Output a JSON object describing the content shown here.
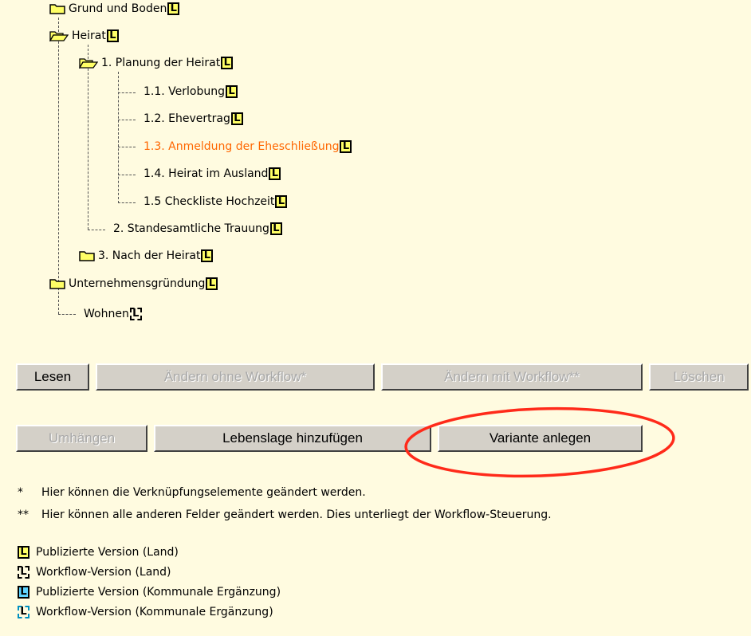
{
  "tree": {
    "items": [
      {
        "label": "Grund und Boden",
        "badge": "L"
      },
      {
        "label": "Heirat",
        "badge": "L"
      },
      {
        "label": "1. Planung der Heirat",
        "badge": "L"
      },
      {
        "label": "1.1. Verlobung",
        "badge": "L"
      },
      {
        "label": "1.2. Ehevertrag",
        "badge": "L"
      },
      {
        "label": "1.3. Anmeldung der Eheschließung",
        "badge": "L",
        "selected": true
      },
      {
        "label": "1.4. Heirat im Ausland",
        "badge": "L"
      },
      {
        "label": "1.5 Checkliste Hochzeit",
        "badge": "L"
      },
      {
        "label": "2. Standesamtliche Trauung",
        "badge": "L"
      },
      {
        "label": "3. Nach der Heirat",
        "badge": "L"
      },
      {
        "label": "Unternehmensgründung",
        "badge": "L"
      },
      {
        "label": "Wohnen",
        "badge": "L"
      }
    ]
  },
  "buttons": {
    "lesen": "Lesen",
    "aendern_ohne": "Ändern ohne Workflow*",
    "aendern_mit": "Ändern mit Workflow**",
    "loeschen": "Löschen",
    "umhaengen": "Umhängen",
    "lebenslage": "Lebenslage hinzufügen",
    "variante": "Variante anlegen"
  },
  "notes": {
    "note1_marker": "*",
    "note1": "Hier können die Verknüpfungselemente geändert werden.",
    "note2_marker": "**",
    "note2": "Hier können alle anderen Felder geändert werden. Dies unterliegt der Workflow-Steuerung."
  },
  "legend": [
    {
      "badge": "L",
      "text": "Publizierte Version (Land)"
    },
    {
      "badge": "L",
      "text": "Workflow-Version (Land)"
    },
    {
      "badge": "L",
      "text": "Publizierte Version (Kommunale Ergänzung)"
    },
    {
      "badge": "L",
      "text": "Workflow-Version (Kommunale Ergänzung)"
    }
  ],
  "colors": {
    "background": "#fffbe0",
    "selected_item": "#ff6600",
    "badge_published_land": "#ffff66",
    "badge_published_kommunal": "#5fd4ff",
    "highlight_circle": "#ff2a1a"
  }
}
